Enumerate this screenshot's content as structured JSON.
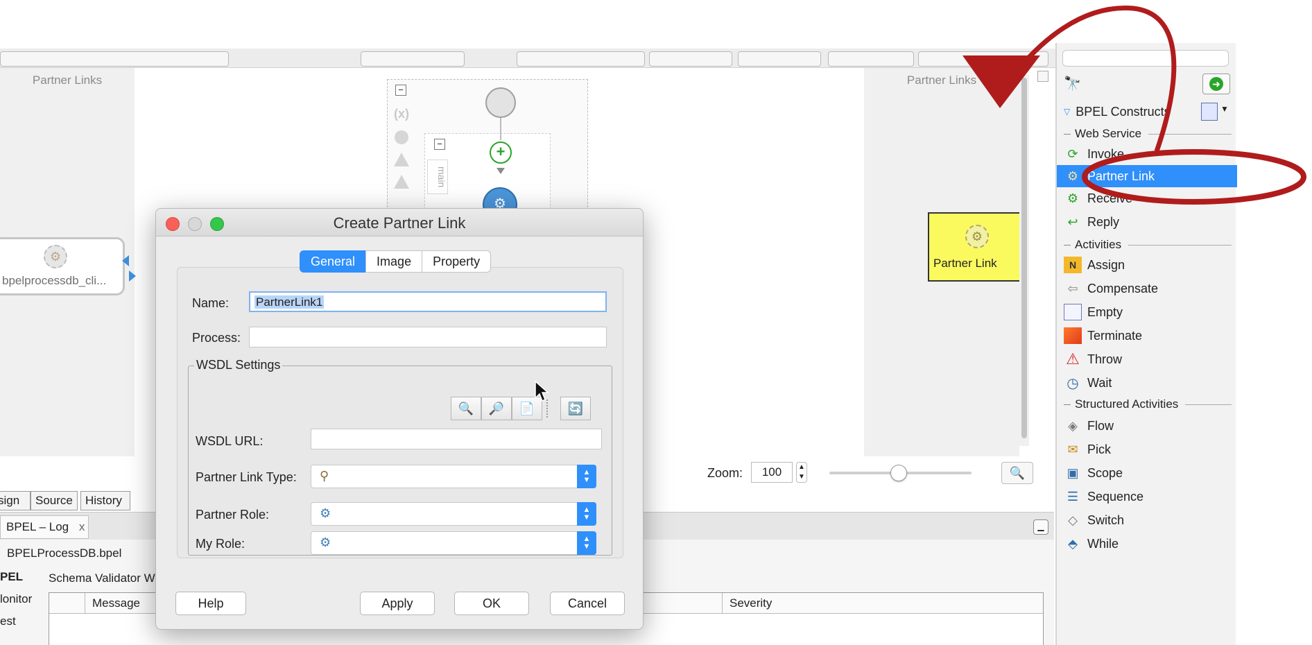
{
  "canvas": {
    "partner_links_left": "Partner Links",
    "partner_links_right": "Partner Links",
    "scope_label": "main",
    "left_node_label": "bpelprocessdb_cli...",
    "right_node_label": "Partner Link"
  },
  "zoom": {
    "label": "Zoom:",
    "value": "100"
  },
  "editor_tabs": [
    "sign",
    "Source",
    "History"
  ],
  "log": {
    "tab_label": "BPEL – Log",
    "tab_close": "x",
    "file": "BPELProcessDB.bpel",
    "side_items": [
      "PEL",
      "lonitor",
      "est"
    ],
    "validator_label": "Schema Validator W",
    "columns": {
      "message": "Message",
      "severity": "Severity"
    }
  },
  "palette": {
    "title": "BPEL Constructs",
    "sections": {
      "web_service": "Web Service",
      "activities": "Activities",
      "structured": "Structured Activities"
    },
    "web_service_items": [
      "Invoke",
      "Partner Link",
      "Receive",
      "Reply"
    ],
    "activity_items": [
      "Assign",
      "Compensate",
      "Empty",
      "Terminate",
      "Throw",
      "Wait"
    ],
    "structured_items": [
      "Flow",
      "Pick",
      "Scope",
      "Sequence",
      "Switch",
      "While"
    ],
    "selected_item": "Partner Link",
    "selected_color": "#2f8ffb"
  },
  "dialog": {
    "title": "Create Partner Link",
    "tabs": [
      "General",
      "Image",
      "Property"
    ],
    "active_tab": "General",
    "name_label": "Name:",
    "name_value": "PartnerLink1",
    "process_label": "Process:",
    "process_value": "",
    "wsdl_settings_label": "WSDL Settings",
    "wsdl_url_label": "WSDL URL:",
    "wsdl_url_value": "",
    "partner_link_type_label": "Partner Link Type:",
    "partner_role_label": "Partner Role:",
    "my_role_label": "My Role:",
    "buttons": {
      "help": "Help",
      "apply": "Apply",
      "ok": "OK",
      "cancel": "Cancel"
    }
  },
  "colors": {
    "annotation": "#b01c1c",
    "highlight_node": "#fafa5f",
    "accent": "#2f8ffb"
  }
}
